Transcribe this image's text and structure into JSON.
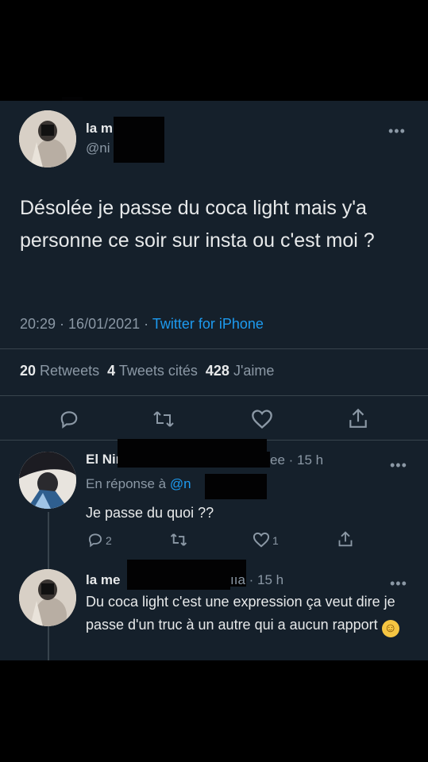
{
  "tweet": {
    "author_name": "la m",
    "author_handle": "@ni",
    "text": "Désolée je passe du coca light mais y'a personne ce soir sur insta ou c'est moi ?",
    "time": "20:29",
    "date": "16/01/2021",
    "source": "Twitter for iPhone",
    "retweets_count": "20",
    "retweets_label": "Retweets",
    "quotes_count": "4",
    "quotes_label": "Tweets cités",
    "likes_count": "428",
    "likes_label": "J'aime"
  },
  "replies": [
    {
      "author_name": "El Niñ",
      "meta_tail": "ee · 15 h",
      "reply_to_label": "En réponse à",
      "reply_to_handle": "@n",
      "text": "Je passe du quoi ??",
      "reply_count": "2",
      "like_count": "1"
    },
    {
      "author_name": "la me",
      "meta_tail": "ııa · 15 h",
      "text": "Du coca light c'est une expression ça veut dire je passe d'un truc à un autre qui a aucun rapport",
      "emoji": "☺"
    }
  ],
  "icons": [
    "reply-icon",
    "retweet-icon",
    "like-icon",
    "share-icon",
    "more-icon",
    "relieved-emoji"
  ],
  "colors": {
    "background": "#15202b",
    "link": "#1d9bf0",
    "muted": "#8b98a5",
    "text": "#e7e9ea"
  }
}
